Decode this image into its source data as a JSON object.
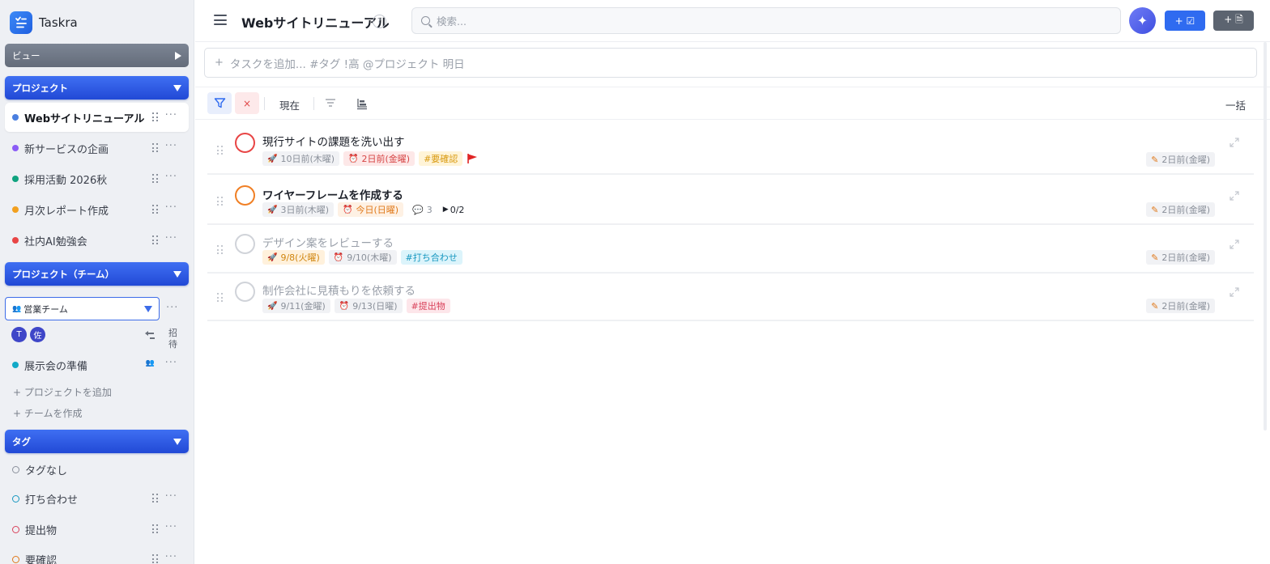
{
  "app": {
    "name": "Taskra"
  },
  "colors": {
    "accent": "#2f6bf0",
    "sidebar_bg": "#eef0f4",
    "section_blue": "#2149d6",
    "section_gray": "#646c7a"
  },
  "sidebar": {
    "view_label": "ビュー",
    "projects_label": "プロジェクト",
    "projects": [
      {
        "label": "Webサイトリニューアル",
        "color": "#4a7fe0",
        "active": true
      },
      {
        "label": "新サービスの企画",
        "color": "#8b5cf6",
        "active": false
      },
      {
        "label": "採用活動 2026秋",
        "color": "#10a37f",
        "active": false
      },
      {
        "label": "月次レポート作成",
        "color": "#f2a01f",
        "active": false
      },
      {
        "label": "社内AI勉強会",
        "color": "#e84545",
        "active": false
      }
    ],
    "team_projects_label": "プロジェクト（チーム）",
    "team_select_value": "営業チーム",
    "members": [
      "T",
      "佐"
    ],
    "invite_label": "招待",
    "team_projects": [
      {
        "label": "展示会の準備",
        "color": "#12a9c7"
      }
    ],
    "add_project_label": "+ プロジェクトを追加",
    "create_team_label": "+ チームを作成",
    "tags_label": "タグ",
    "tags": [
      {
        "label": "タグなし",
        "color": "#8b919c"
      },
      {
        "label": "打ち合わせ",
        "color": "#1898c0"
      },
      {
        "label": "提出物",
        "color": "#d9415a"
      },
      {
        "label": "要確認",
        "color": "#e0791a"
      }
    ]
  },
  "header": {
    "title": "Webサイトリニューアル",
    "help": "?",
    "search_placeholder": "検索...",
    "ai_icon": "sparkle-icon",
    "add_task_label": "+ ☑",
    "add_doc_label": "+ 🗎"
  },
  "quick_add": {
    "placeholder": "タスクを追加... #タグ !高 @プロジェクト 明日"
  },
  "toolbar": {
    "clear": "×",
    "now_label": "現在",
    "bulk_label": "一括"
  },
  "tasks": [
    {
      "title": "現行サイトの課題を洗い出す",
      "ring_color": "#e84545",
      "start": "10日前(木曜)",
      "due": "2日前(金曜)",
      "tag": "#要確認",
      "flag": true,
      "updated": "2日前(金曜)",
      "done": false
    },
    {
      "title": "ワイヤーフレームを作成する",
      "ring_color": "#f07f24",
      "start": "3日前(木曜)",
      "due": "今日(日曜)",
      "comments": "3",
      "subtasks": "0/2",
      "updated": "2日前(金曜)",
      "done": false
    },
    {
      "title": "デザイン案をレビューする",
      "ring_color": "#d0d3d9",
      "start": "9/8(火曜)",
      "due": "9/10(木曜)",
      "tag": "#打ち合わせ",
      "updated": "2日前(金曜)",
      "done": true
    },
    {
      "title": "制作会社に見積もりを依頼する",
      "ring_color": "#d0d3d9",
      "start": "9/11(金曜)",
      "due": "9/13(日曜)",
      "tag": "#提出物",
      "updated": "2日前(金曜)",
      "done": true
    }
  ]
}
